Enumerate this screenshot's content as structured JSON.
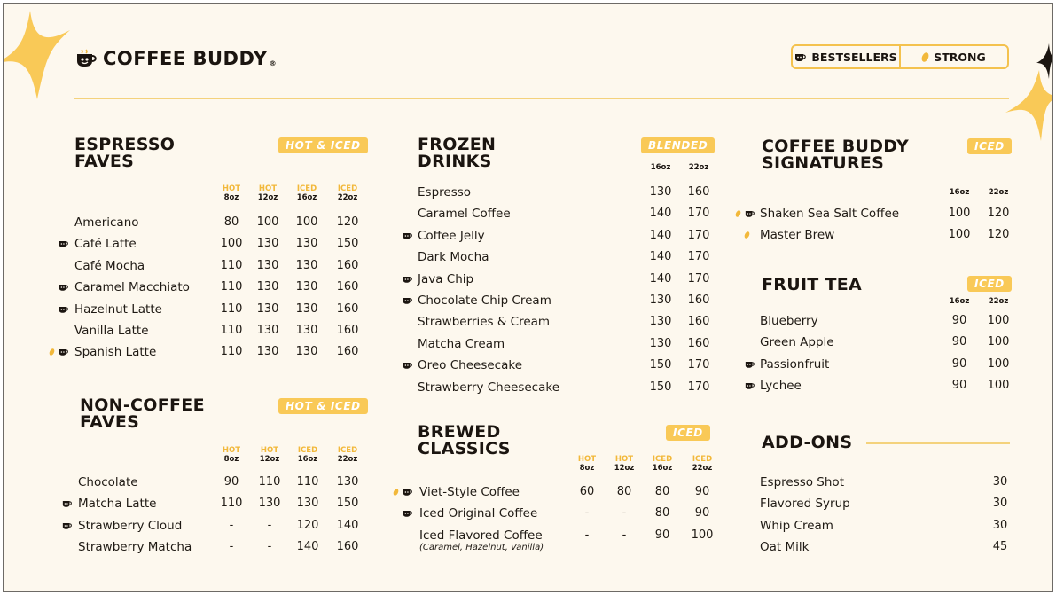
{
  "brand": {
    "name": "COFFEE BUDDY",
    "registered": "®"
  },
  "legend": {
    "bestsellers": "BESTSELLERS",
    "strong": "STRONG"
  },
  "colors": {
    "accent": "#f9c957",
    "text": "#1b1510",
    "background": "#fdf8ee"
  },
  "sections": {
    "espresso": {
      "title": "ESPRESSO\nFAVES",
      "badge": "HOT & ICED",
      "columns": [
        [
          "HOT",
          "8oz"
        ],
        [
          "HOT",
          "12oz"
        ],
        [
          "ICED",
          "16oz"
        ],
        [
          "ICED",
          "22oz"
        ]
      ],
      "items": [
        {
          "name": "Americano",
          "prices": [
            "80",
            "100",
            "100",
            "120"
          ],
          "best": false,
          "strong": false
        },
        {
          "name": "Café Latte",
          "prices": [
            "100",
            "130",
            "130",
            "150"
          ],
          "best": true,
          "strong": false
        },
        {
          "name": "Café Mocha",
          "prices": [
            "110",
            "130",
            "130",
            "160"
          ],
          "best": false,
          "strong": false
        },
        {
          "name": "Caramel Macchiato",
          "prices": [
            "110",
            "130",
            "130",
            "160"
          ],
          "best": true,
          "strong": false
        },
        {
          "name": "Hazelnut Latte",
          "prices": [
            "110",
            "130",
            "130",
            "160"
          ],
          "best": true,
          "strong": false
        },
        {
          "name": "Vanilla Latte",
          "prices": [
            "110",
            "130",
            "130",
            "160"
          ],
          "best": false,
          "strong": false
        },
        {
          "name": "Spanish Latte",
          "prices": [
            "110",
            "130",
            "130",
            "160"
          ],
          "best": true,
          "strong": true
        }
      ]
    },
    "noncoffee": {
      "title": "NON-COFFEE\nFAVES",
      "badge": "HOT & ICED",
      "columns": [
        [
          "HOT",
          "8oz"
        ],
        [
          "HOT",
          "12oz"
        ],
        [
          "ICED",
          "16oz"
        ],
        [
          "ICED",
          "22oz"
        ]
      ],
      "items": [
        {
          "name": "Chocolate",
          "prices": [
            "90",
            "110",
            "110",
            "130"
          ],
          "best": false,
          "strong": false
        },
        {
          "name": "Matcha Latte",
          "prices": [
            "110",
            "130",
            "130",
            "150"
          ],
          "best": true,
          "strong": false
        },
        {
          "name": "Strawberry Cloud",
          "prices": [
            "-",
            "-",
            "120",
            "140"
          ],
          "best": true,
          "strong": false
        },
        {
          "name": "Strawberry Matcha",
          "prices": [
            "-",
            "-",
            "140",
            "160"
          ],
          "best": false,
          "strong": false
        }
      ]
    },
    "frozen": {
      "title": "FROZEN\nDRINKS",
      "badge": "BLENDED",
      "columns": [
        [
          "",
          "16oz"
        ],
        [
          "",
          "22oz"
        ]
      ],
      "items": [
        {
          "name": "Espresso",
          "prices": [
            "130",
            "160"
          ],
          "best": false,
          "strong": false
        },
        {
          "name": "Caramel Coffee",
          "prices": [
            "140",
            "170"
          ],
          "best": false,
          "strong": false
        },
        {
          "name": "Coffee Jelly",
          "prices": [
            "140",
            "170"
          ],
          "best": true,
          "strong": false
        },
        {
          "name": "Dark Mocha",
          "prices": [
            "140",
            "170"
          ],
          "best": false,
          "strong": false
        },
        {
          "name": "Java Chip",
          "prices": [
            "140",
            "170"
          ],
          "best": true,
          "strong": false
        },
        {
          "name": "Chocolate Chip Cream",
          "prices": [
            "130",
            "160"
          ],
          "best": true,
          "strong": false
        },
        {
          "name": "Strawberries & Cream",
          "prices": [
            "130",
            "160"
          ],
          "best": false,
          "strong": false
        },
        {
          "name": "Matcha Cream",
          "prices": [
            "130",
            "160"
          ],
          "best": false,
          "strong": false
        },
        {
          "name": "Oreo Cheesecake",
          "prices": [
            "150",
            "170"
          ],
          "best": true,
          "strong": false
        },
        {
          "name": "Strawberry Cheesecake",
          "prices": [
            "150",
            "170"
          ],
          "best": false,
          "strong": false
        }
      ]
    },
    "brewed": {
      "title": "BREWED\nCLASSICS",
      "badge": "ICED",
      "columns": [
        [
          "HOT",
          "8oz"
        ],
        [
          "HOT",
          "12oz"
        ],
        [
          "ICED",
          "16oz"
        ],
        [
          "ICED",
          "22oz"
        ]
      ],
      "items": [
        {
          "name": "Viet-Style Coffee",
          "prices": [
            "60",
            "80",
            "80",
            "90"
          ],
          "best": true,
          "strong": true
        },
        {
          "name": "Iced Original Coffee",
          "prices": [
            "-",
            "-",
            "80",
            "90"
          ],
          "best": true,
          "strong": false
        },
        {
          "name": "Iced Flavored Coffee",
          "prices": [
            "-",
            "-",
            "90",
            "100"
          ],
          "best": false,
          "strong": false,
          "note": "(Caramel, Hazelnut, Vanilla)"
        }
      ]
    },
    "signatures": {
      "title": "COFFEE BUDDY\nSIGNATURES",
      "badge": "ICED",
      "columns": [
        [
          "",
          "16oz"
        ],
        [
          "",
          "22oz"
        ]
      ],
      "items": [
        {
          "name": "Shaken Sea Salt Coffee",
          "prices": [
            "100",
            "120"
          ],
          "best": true,
          "strong": true
        },
        {
          "name": "Master Brew",
          "prices": [
            "100",
            "120"
          ],
          "best": false,
          "strong": true
        }
      ]
    },
    "fruittea": {
      "title": "FRUIT TEA",
      "badge": "ICED",
      "columns": [
        [
          "",
          "16oz"
        ],
        [
          "",
          "22oz"
        ]
      ],
      "items": [
        {
          "name": "Blueberry",
          "prices": [
            "90",
            "100"
          ],
          "best": false,
          "strong": false
        },
        {
          "name": "Green Apple",
          "prices": [
            "90",
            "100"
          ],
          "best": false,
          "strong": false
        },
        {
          "name": "Passionfruit",
          "prices": [
            "90",
            "100"
          ],
          "best": true,
          "strong": false
        },
        {
          "name": "Lychee",
          "prices": [
            "90",
            "100"
          ],
          "best": true,
          "strong": false
        }
      ]
    },
    "addons": {
      "title": "ADD-ONS",
      "items": [
        {
          "name": "Espresso Shot",
          "price": "30"
        },
        {
          "name": "Flavored Syrup",
          "price": "30"
        },
        {
          "name": "Whip Cream",
          "price": "30"
        },
        {
          "name": "Oat Milk",
          "price": "45"
        }
      ]
    }
  }
}
